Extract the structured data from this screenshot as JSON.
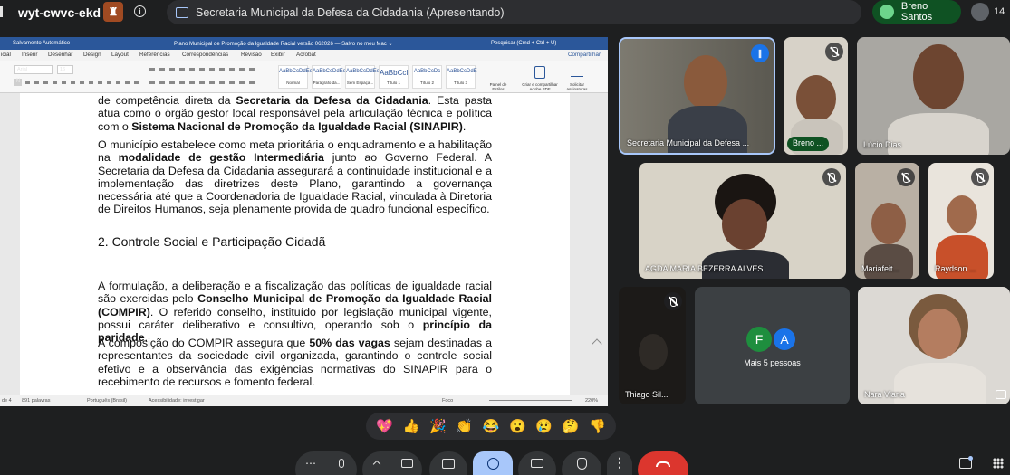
{
  "meeting": {
    "code": "wyt-cwvc-ekd",
    "presenting_label": "Secretaria Municipal da Defesa da Cidadania (Apresentando)",
    "presenter_user": "Breno Santos",
    "participant_count": "14"
  },
  "document": {
    "title_bar": {
      "autosave": "Salvamento Automático",
      "filename": "Plano Municipal de Promoção da Igualdade Racial versão 062026 — Salvo no meu Mac ⌄",
      "search": "Pesquisar (Cmd + Ctrl + U)"
    },
    "menu": [
      "icial",
      "Inserir",
      "Desenhar",
      "Design",
      "Layout",
      "Referências",
      "Correspondências",
      "Revisão",
      "Exibir",
      "Acrobat"
    ],
    "share_label": "Compartilhar",
    "font_name": "Arial",
    "font_size": "16",
    "styles": [
      {
        "preview": "AaBbCcDdEe",
        "name": "Normal"
      },
      {
        "preview": "AaBbCcDdEe",
        "name": "Parágrafo da..."
      },
      {
        "preview": "AaBbCcDdEe",
        "name": "Sem Espaça..."
      },
      {
        "preview": "AaBbCcI",
        "name": "Título 1"
      },
      {
        "preview": "AaBbCcDc",
        "name": "Título 2"
      },
      {
        "preview": "AaBbCcDdE",
        "name": "Título 3"
      }
    ],
    "ribbon_extra": [
      "Painel de Estilos",
      "Criar e compartilhar Adobe PDF",
      "Solicitar assinaturas"
    ],
    "paragraphs": {
      "p1_a": "de competência direta da ",
      "p1_b": "Secretaria da Defesa da Cidadania",
      "p1_c": ". Esta pasta atua como o órgão gestor local responsável pela articulação técnica e política com o ",
      "p1_d": "Sistema Nacional de Promoção da Igualdade Racial (SINAPIR)",
      "p1_e": ".",
      "p2_a": "O município estabelece como meta prioritária o enquadramento e a habilitação na ",
      "p2_b": "modalidade de gestão Intermediária",
      "p2_c": " junto ao Governo Federal. A Secretaria da Defesa da Cidadania assegurará a continuidade institucional e a implementação das diretrizes deste Plano, garantindo a governança necessária até que a Coordenadoria de Igualdade Racial, vinculada à Diretoria de Direitos Humanos, seja plenamente provida de quadro funcional específico.",
      "heading": "2. Controle Social e Participação Cidadã",
      "p3_a": "A formulação, a deliberação e a fiscalização das políticas de igualdade racial são exercidas pelo ",
      "p3_b": "Conselho Municipal de Promoção da Igualdade Racial (COMPIR)",
      "p3_c": ". O referido conselho, instituído por legislação municipal vigente, possui caráter deliberativo e consultivo, operando sob o ",
      "p3_d": "princípio da paridade",
      "p3_e": ".",
      "p4_a": "A composição do COMPIR assegura que ",
      "p4_b": "50% das vagas",
      "p4_c": " sejam destinadas a representantes da sociedade civil organizada, garantindo o controle social efetivo e a observância das exigências normativas do SINAPIR para o recebimento de recursos e fomento federal."
    },
    "status": {
      "page": "de 4",
      "words": "891 palavras",
      "language": "Português (Brasil)",
      "accessibility": "Acessibilidade: investigar",
      "focus": "Foco",
      "zoom": "220%"
    }
  },
  "participants": [
    {
      "name": "Secretaria Municipal da Defesa ...",
      "speaking": true
    },
    {
      "name": "Breno ...",
      "muted": true
    },
    {
      "name": "Lúcio Dias"
    },
    {
      "name": "AGDA MARIA BEZERRA ALVES",
      "muted": true
    },
    {
      "name": "Mariafeit...",
      "muted": true
    },
    {
      "name": "Raydson ...",
      "muted": true
    },
    {
      "name": "Thiago Sil...",
      "muted": true
    },
    {
      "name": "Nara Viana"
    }
  ],
  "others": {
    "avatars": [
      "F",
      "A"
    ],
    "label": "Mais 5 pessoas",
    "colors": [
      "#1e8e3e",
      "#1a73e8"
    ]
  },
  "reactions": [
    "💖",
    "👍",
    "🎉",
    "👏",
    "😂",
    "😮",
    "😢",
    "🤔",
    "👎"
  ],
  "colors": {
    "end_call": "#dc362e",
    "active_control": "#a8c7fa",
    "presenter_pill": "#0f5223",
    "word_blue": "#2b579a"
  }
}
